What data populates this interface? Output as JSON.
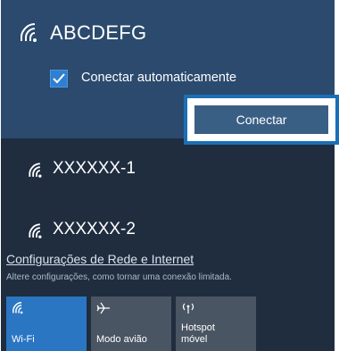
{
  "selected_network": {
    "name": "ABCDEFG",
    "auto_connect_label": "Conectar automaticamente",
    "auto_connect_checked": true,
    "connect_button": "Conectar"
  },
  "networks": [
    {
      "name": "XXXXXX-1"
    },
    {
      "name": "XXXXXX-2"
    }
  ],
  "settings": {
    "link": "Configurações de Rede e Internet",
    "description": "Altere configurações, como tornar uma conexão limitada."
  },
  "quick_actions": [
    {
      "label": "Wi-Fi",
      "icon": "wifi-icon",
      "active": true
    },
    {
      "label": "Modo avião",
      "icon": "airplane-icon",
      "active": false
    },
    {
      "label": "Hotspot\nmóvel",
      "icon": "hotspot-icon",
      "active": false
    }
  ],
  "colors": {
    "panel_bg": "#1f2d3f",
    "selected_bg": "#2b4a6e",
    "accent": "#2a76c3",
    "highlight_frame": "#1a6fb5"
  }
}
